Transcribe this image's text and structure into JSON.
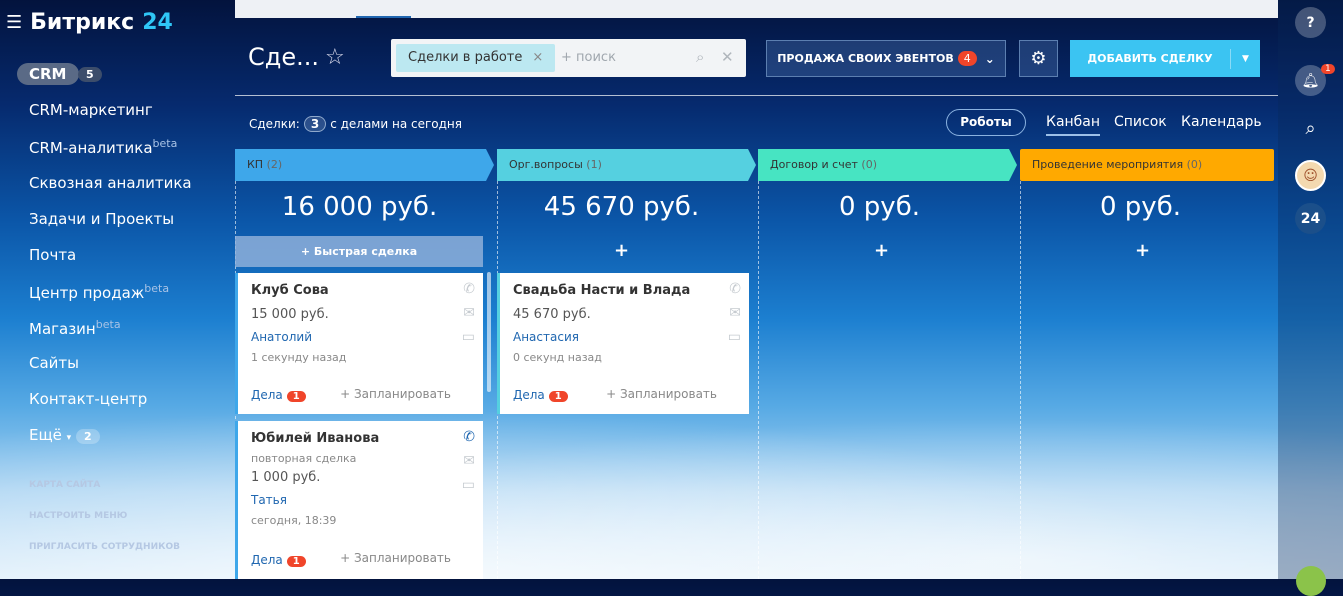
{
  "sidebar": {
    "logo_main": "Битрикс",
    "logo_num": "24",
    "crm": "CRM",
    "crm_count": "5",
    "items": [
      {
        "label": "CRM-маркетинг"
      },
      {
        "label": "CRM-аналитика",
        "sup": "beta"
      },
      {
        "label": "Сквозная аналитика"
      },
      {
        "label": "Задачи и Проекты"
      },
      {
        "label": "Почта"
      },
      {
        "label": "Центр продаж",
        "sup": "beta"
      },
      {
        "label": "Магазин",
        "sup": "beta"
      },
      {
        "label": "Сайты"
      },
      {
        "label": "Контакт-центр"
      }
    ],
    "more": "Ещё",
    "more_count": "2",
    "sitemap": "КАРТА САЙТА",
    "configure": "НАСТРОИТЬ МЕНЮ",
    "invite": "ПРИГЛАСИТЬ СОТРУДНИКОВ"
  },
  "header": {
    "title": "Сде...",
    "filter_chip": "Сделки в работе",
    "search_placeholder": "+ поиск",
    "category": "ПРОДАЖА СВОИХ ЭВЕНТОВ",
    "category_badge": "4",
    "add": "ДОБАВИТЬ СДЕЛКУ"
  },
  "toolbar": {
    "counter_label": "Сделки:",
    "counter": "3",
    "counter_text": "с делами на сегодня",
    "robots": "Роботы",
    "views": [
      "Канбан",
      "Список",
      "Календарь"
    ]
  },
  "columns": [
    {
      "name": "КП",
      "count": "(2)",
      "sum": "16 000 руб.",
      "color": "#3ea7ea"
    },
    {
      "name": "Орг.вопросы",
      "count": "(1)",
      "sum": "45 670 руб.",
      "color": "#55d0e0"
    },
    {
      "name": "Договор и счет",
      "count": "(0)",
      "sum": "0 руб.",
      "color": "#47e4c2"
    },
    {
      "name": "Проведение мероприятия",
      "count": "(0)",
      "sum": "0 руб.",
      "color": "#ffa900"
    }
  ],
  "quick_deal": "Быстрая сделка",
  "add_plus": "+",
  "cards": [
    {
      "title": "Клуб Сова",
      "sum": "15 000 руб.",
      "contact": "Анатолий",
      "time": "1 секунду назад",
      "tasks": "Дела",
      "tasks_count": "1",
      "plan": "+ Запланировать"
    },
    {
      "title": "Свадьба Насти и Влада",
      "sum": "45 670 руб.",
      "contact": "Анастасия",
      "time": "0 секунд назад",
      "tasks": "Дела",
      "tasks_count": "1",
      "plan": "+ Запланировать"
    },
    {
      "title": "Юбилей Иванова",
      "subtitle": "повторная сделка",
      "sum": "1 000 руб.",
      "contact": "Татья",
      "time": "сегодня, 18:39",
      "tasks": "Дела",
      "tasks_count": "1",
      "plan": "+ Запланировать"
    }
  ],
  "right": {
    "help": "?",
    "notif_count": "1",
    "b24": "24"
  }
}
